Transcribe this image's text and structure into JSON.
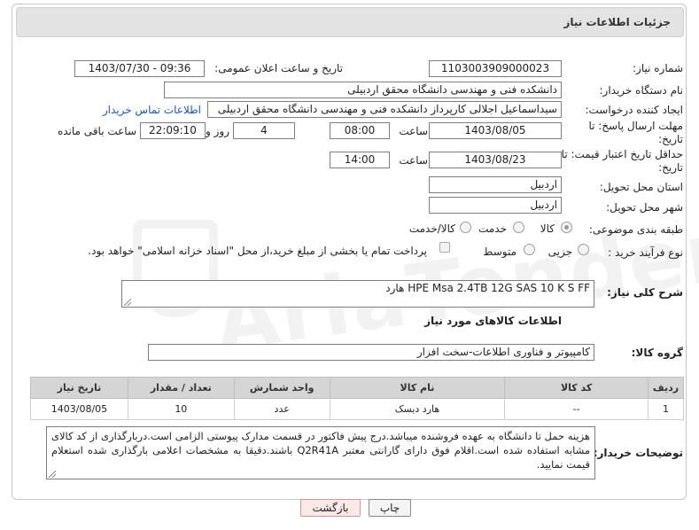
{
  "header": {
    "title": "جزئیات اطلاعات نیاز"
  },
  "fields": {
    "need_number_label": "شماره نیاز:",
    "need_number": "1103003909000023",
    "announce_label": "تاریخ و ساعت اعلان عمومی:",
    "announce_value": "1403/07/30 - 09:36",
    "buyer_org_label": "نام دستگاه خریدار:",
    "buyer_org": "دانشکده فنی و مهندسی دانشگاه محقق اردبیلی",
    "creator_label": "ایجاد کننده درخواست:",
    "creator": "سیداسماعیل اجلالی کارپرداز دانشکده فنی و مهندسی دانشگاه محقق اردبیلی",
    "contact_link": "اطلاعات تماس خریدار",
    "reply_deadline_label": "مهلت ارسال پاسخ: تا تاریخ:",
    "reply_date": "1403/08/05",
    "time_label": "ساعت",
    "reply_time": "08:00",
    "days_value": "4",
    "days_label": "روز و",
    "remaining_time": "22:09:10",
    "remaining_label": "ساعت باقی مانده",
    "price_validity_label": "حداقل تاریخ اعتبار قیمت: تا تاریخ:",
    "price_date": "1403/08/23",
    "price_time": "14:00",
    "province_label": "استان محل تحویل:",
    "province": "اردبیل",
    "city_label": "شهر محل تحویل:",
    "city": "اردبیل",
    "category_label": "طبقه بندی موضوعی:",
    "category_options": [
      "کالا",
      "خدمت",
      "کالا/خدمت"
    ],
    "purchase_type_label": "نوع فرآیند خرید :",
    "purchase_options": [
      "جزیی",
      "متوسط"
    ],
    "payment_note": "پرداخت تمام یا بخشی از مبلغ خرید،از محل \"اسناد خزانه اسلامی\" خواهد بود.",
    "description_label": "شرح کلی نیاز:",
    "description": "هارد  HPE Msa  2.4TB  12G  SAS  10 K S FF",
    "goods_info_title": "اطلاعات کالاهای مورد نیاز",
    "goods_group_label": "گروه کالا:",
    "goods_group": "کامپیوتر و فناوری اطلاعات-سخت افزار",
    "buyer_notes_label": "توضیحات خریدار:",
    "buyer_notes": "هزینه حمل تا دانشگاه به عهده فروشنده میباشد.درج پیش فاکتور در قسمت مدارک پیوستی الزامی است.دربارگذاری از کد کالای مشابه استفاده شده است.اقلام فوق دارای گارانتی معتبر Q2R41A باشند.دقیقا به مشخصات اعلامی بارگذاری شده استعلام قیمت نمایید."
  },
  "table": {
    "headers": [
      "ردیف",
      "کد کالا",
      "نام کالا",
      "واحد شمارش",
      "تعداد / مقدار",
      "تاریخ نیاز"
    ],
    "rows": [
      [
        "1",
        "--",
        "هارد دیسک",
        "عدد",
        "10",
        "1403/08/05"
      ]
    ]
  },
  "buttons": {
    "print": "چاپ",
    "back": "بازگشت"
  },
  "watermark": "AriaTender.neT"
}
